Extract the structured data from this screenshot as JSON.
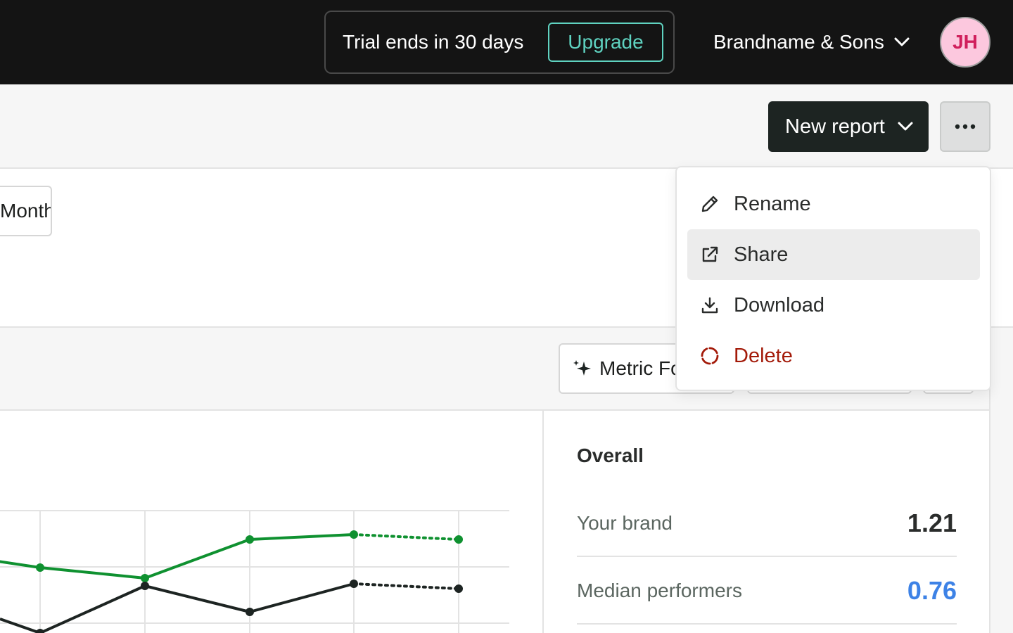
{
  "header": {
    "trial_text": "Trial ends in 30 days",
    "upgrade_label": "Upgrade",
    "brand_name": "Brandname & Sons",
    "avatar_initials": "JH"
  },
  "toolbar": {
    "new_report_label": "New report",
    "more_icon": "more-horizontal-icon"
  },
  "filters": {
    "period_chip": "Month"
  },
  "metric_bar": {
    "metric_button_label": "Metric Fo"
  },
  "menu": {
    "items": [
      {
        "label": "Rename",
        "icon": "pencil-icon"
      },
      {
        "label": "Share",
        "icon": "external-link-icon",
        "highlighted": true
      },
      {
        "label": "Download",
        "icon": "download-icon"
      },
      {
        "label": "Delete",
        "icon": "delete-icon",
        "danger": true
      }
    ]
  },
  "overall": {
    "title": "Overall",
    "rows": [
      {
        "label": "Your brand",
        "value": "1.21",
        "color": "#2a2c2b"
      },
      {
        "label": "Median performers",
        "value": "0.76",
        "color": "#3d82e6"
      }
    ]
  },
  "colors": {
    "accent": "#5fd2c0",
    "brand_series": "#0f9130",
    "median_series": "#1d2422",
    "danger": "#a31a09",
    "avatar_bg": "#fcc8de"
  }
}
